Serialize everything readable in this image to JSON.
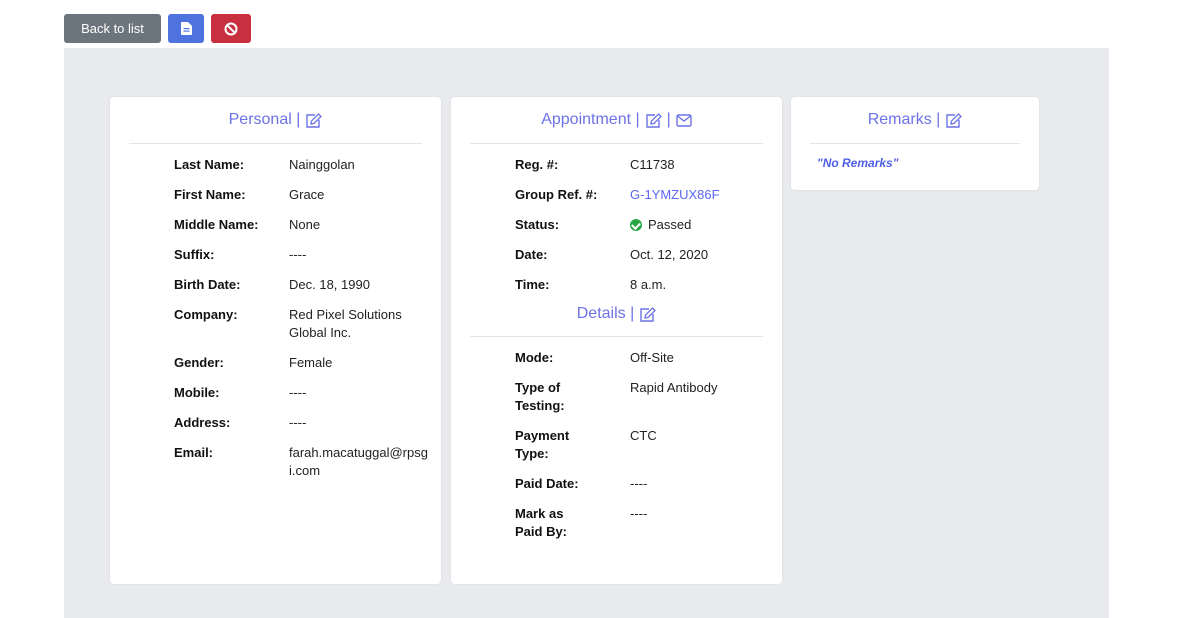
{
  "toolbar": {
    "back_label": "Back to list",
    "doc_icon": "document-icon",
    "cancel_icon": "ban-icon"
  },
  "personal": {
    "title": "Personal |",
    "rows": [
      {
        "label": "Last Name:",
        "value": "Nainggolan"
      },
      {
        "label": "First Name:",
        "value": "Grace"
      },
      {
        "label": "Middle Name:",
        "value": "None"
      },
      {
        "label": "Suffix:",
        "value": "----"
      },
      {
        "label": "Birth Date:",
        "value": "Dec. 18, 1990"
      },
      {
        "label": "Company:",
        "value": "Red Pixel Solutions Global Inc."
      },
      {
        "label": "Gender:",
        "value": "Female"
      },
      {
        "label": "Mobile:",
        "value": "----"
      },
      {
        "label": "Address:",
        "value": "----"
      },
      {
        "label": "Email:",
        "value": "farah.macatuggal@rpsgi.com"
      }
    ]
  },
  "appointment": {
    "title": "Appointment |",
    "title_sep": "|",
    "rows": [
      {
        "label": "Reg. #:",
        "value": "C11738"
      },
      {
        "label": "Group Ref. #:",
        "value": "G-1YMZUX86F"
      },
      {
        "label": "Status:",
        "value": "Passed"
      },
      {
        "label": "Date:",
        "value": "Oct. 12, 2020"
      },
      {
        "label": "Time:",
        "value": "8 a.m."
      }
    ]
  },
  "details": {
    "title": "Details |",
    "rows": [
      {
        "label": "Mode:",
        "value": "Off-Site"
      },
      {
        "label": "Type of Testing:",
        "value": "Rapid Antibody"
      },
      {
        "label": "Payment Type:",
        "value": "CTC"
      },
      {
        "label": "Paid Date:",
        "value": "----"
      },
      {
        "label": "Mark as Paid By:",
        "value": "----"
      }
    ]
  },
  "remarks": {
    "title": "Remarks |",
    "text": "\"No Remarks\""
  },
  "colors": {
    "accent": "#6c72e6",
    "link": "#5a67f2",
    "success": "#28a745",
    "danger": "#c9303f",
    "secondary": "#6c757d",
    "primary": "#4e73df"
  }
}
